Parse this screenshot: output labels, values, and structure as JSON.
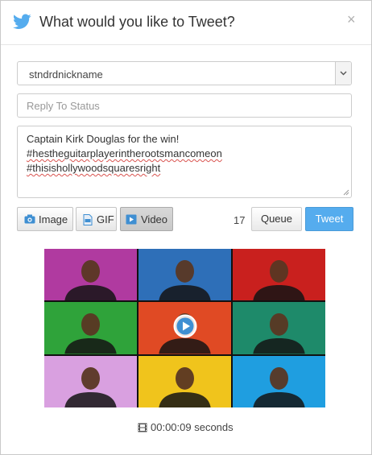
{
  "dialog": {
    "title": "What would you like to Tweet?",
    "close_glyph": "×",
    "brand_color": "#55acee"
  },
  "account_select": {
    "value": "stndrdnickname"
  },
  "reply_input": {
    "placeholder": "Reply To Status",
    "value": ""
  },
  "tweet_text": {
    "line1": "Captain Kirk Douglas for the win!",
    "line2": "#hestheguitarplayerintherootsmancomeon",
    "line3": "#thisishollywoodsquaresright"
  },
  "toolbar": {
    "image_label": "Image",
    "gif_label": "GIF",
    "video_label": "Video",
    "char_count": "17",
    "queue_label": "Queue",
    "tweet_label": "Tweet"
  },
  "media": {
    "type": "video",
    "grid": {
      "rows": 3,
      "cols": 3
    },
    "tile_colors": [
      "#b03aa0",
      "#2e6fb8",
      "#c9201e",
      "#2fa33a",
      "#e04a24",
      "#1e8a6a",
      "#d9a0e0",
      "#f0c41c",
      "#1f9ee0"
    ],
    "duration": "00:00:09 seconds"
  }
}
